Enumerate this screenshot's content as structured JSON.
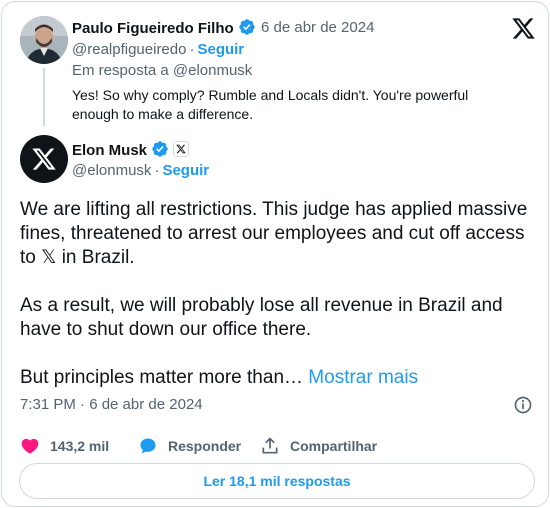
{
  "reply_tweet": {
    "author_name": "Paulo Figueiredo Filho",
    "verified_icon": "verified-badge-icon",
    "date": "6 de abr de 2024",
    "date_separator": "·",
    "handle": "@realpfigueiredo",
    "handle_separator": "·",
    "follow_label": "Seguir",
    "reply_to": "Em resposta a @elonmusk",
    "text": "Yes! So why comply? Rumble and Locals didn't. You're powerful enough to make a difference."
  },
  "main_tweet": {
    "author_name": "Elon Musk",
    "verified_icon": "verified-badge-icon",
    "affiliation_icon": "x-affiliation-icon",
    "handle": "@elonmusk",
    "handle_separator": "·",
    "follow_label": "Seguir",
    "paragraphs": [
      "We are lifting all restrictions. This judge has applied massive fines, threatened to arrest our employees and cut off access to 𝕏 in Brazil.",
      "As a result, we will probably lose all revenue in Brazil and have to shut down our office there.",
      "But principles matter more than…"
    ],
    "show_more_label": "Mostrar mais",
    "timestamp": "7:31 PM · 6 de abr de 2024"
  },
  "actions": {
    "like_count": "143,2 mil",
    "reply_label": "Responder",
    "share_label": "Compartilhar"
  },
  "read_replies_label": "Ler 18,1 mil respostas",
  "colors": {
    "accent": "#1d9bf0",
    "like": "#f91880",
    "text": "#0f1419",
    "muted": "#536471",
    "border": "#cfd9de"
  }
}
